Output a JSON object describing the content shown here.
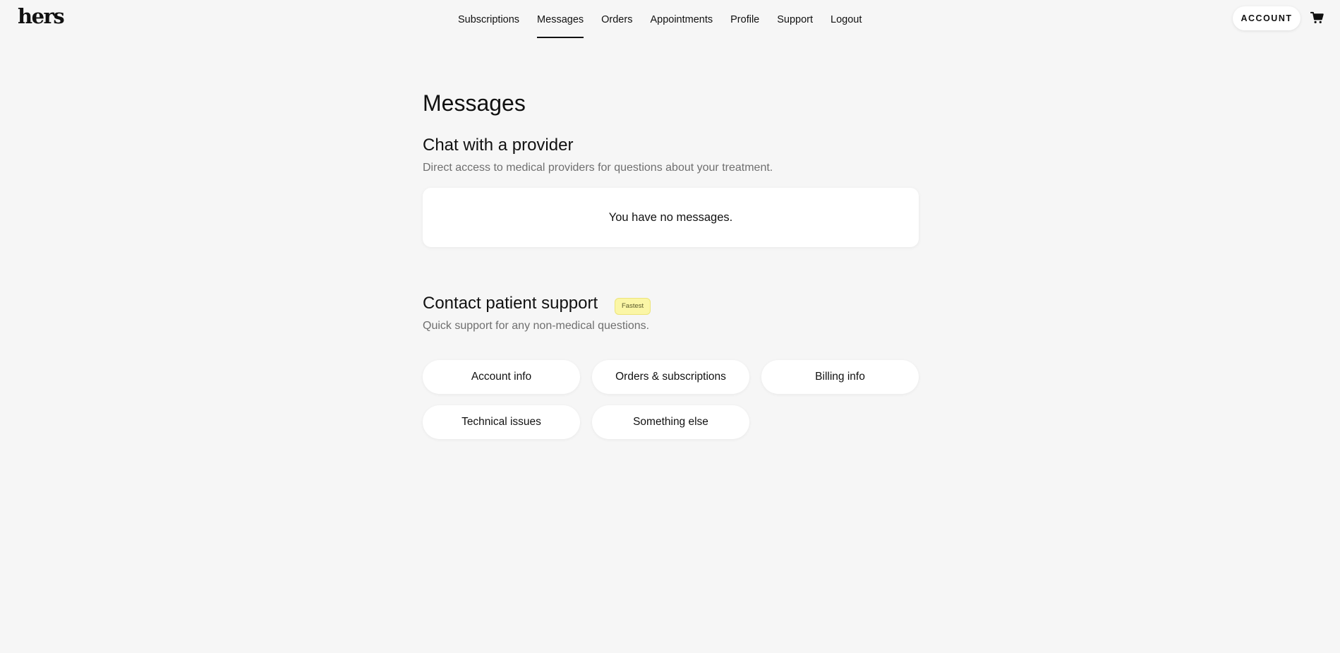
{
  "header": {
    "logo": "hers",
    "nav": [
      {
        "label": "Subscriptions",
        "active": false
      },
      {
        "label": "Messages",
        "active": true
      },
      {
        "label": "Orders",
        "active": false
      },
      {
        "label": "Appointments",
        "active": false
      },
      {
        "label": "Profile",
        "active": false
      },
      {
        "label": "Support",
        "active": false
      },
      {
        "label": "Logout",
        "active": false
      }
    ],
    "account_label": "ACCOUNT",
    "cart_icon": "shopping-cart-icon"
  },
  "main": {
    "title": "Messages",
    "chat": {
      "title": "Chat with a provider",
      "subtitle": "Direct access to medical providers for questions about your treatment.",
      "empty_text": "You have no messages."
    },
    "support": {
      "title": "Contact patient support",
      "badge": "Fastest",
      "subtitle": "Quick support for any non-medical questions.",
      "options": [
        "Account info",
        "Orders & subscriptions",
        "Billing info",
        "Technical issues",
        "Something else"
      ]
    }
  },
  "colors": {
    "background": "#f6f6f6",
    "badge_bg": "#fbf6a6",
    "text": "#111111",
    "muted": "#6f6f6f"
  }
}
